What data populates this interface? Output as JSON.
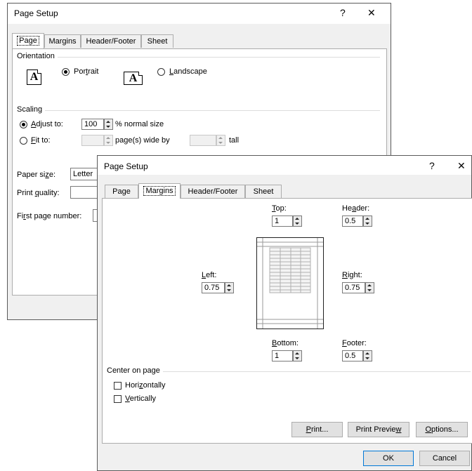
{
  "back_dialog": {
    "title": "Page Setup",
    "help": "?",
    "close": "✕",
    "tabs": [
      "Page",
      "Margins",
      "Header/Footer",
      "Sheet"
    ],
    "orientation": {
      "label": "Orientation",
      "portrait": "Portrait",
      "landscape": "Landscape",
      "icon_letter": "A",
      "selected": "Portrait"
    },
    "scaling": {
      "label": "Scaling",
      "adjust_to": "Adjust to:",
      "adjust_value": "100",
      "normal_size": "% normal size",
      "fit_to": "Fit to:",
      "pages_wide": "page(s) wide by",
      "tall": "tall",
      "selected": "Adjust to:"
    },
    "paper_size": {
      "label": "Paper size:",
      "value": "Letter"
    },
    "print_quality": {
      "label": "Print quality:"
    },
    "first_page_number": {
      "label": "First page number:"
    }
  },
  "front_dialog": {
    "title": "Page Setup",
    "help": "?",
    "close": "✕",
    "tabs": [
      "Page",
      "Margins",
      "Header/Footer",
      "Sheet"
    ],
    "active_tab": "Margins",
    "margins": {
      "top": {
        "label": "Top:",
        "value": "1"
      },
      "header": {
        "label": "Header:",
        "value": "0.5"
      },
      "left": {
        "label": "Left:",
        "value": "0.75"
      },
      "right": {
        "label": "Right:",
        "value": "0.75"
      },
      "bottom": {
        "label": "Bottom:",
        "value": "1"
      },
      "footer": {
        "label": "Footer:",
        "value": "0.5"
      }
    },
    "center_on_page": {
      "label": "Center on page",
      "horizontally": "Horizontally",
      "vertically": "Vertically",
      "horizontally_checked": false,
      "vertically_checked": false
    },
    "buttons": {
      "print": "Print...",
      "print_preview": "Print Preview",
      "options": "Options...",
      "ok": "OK",
      "cancel": "Cancel"
    }
  }
}
